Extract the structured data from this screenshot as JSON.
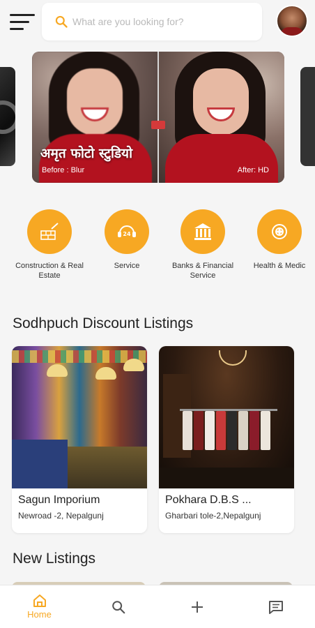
{
  "search": {
    "placeholder": "What are you looking for?"
  },
  "banner": {
    "title": "अमृत फोटो स्टुडियो",
    "before_label": "Before : Blur",
    "after_label": "After: HD"
  },
  "categories": [
    {
      "label": "Construction & Real Estate",
      "icon": "brick-wall-trowel-icon"
    },
    {
      "label": "Service",
      "icon": "24-hour-service-icon"
    },
    {
      "label": "Banks & Financial Service",
      "icon": "bank-building-icon"
    },
    {
      "label": "Health & Medic",
      "icon": "medical-icon"
    }
  ],
  "sections": {
    "discount_title": "Sodhpuch Discount Listings",
    "new_title": "New Listings"
  },
  "listings": [
    {
      "name": "Sagun Imporium",
      "address": "Newroad -2, Nepalgunj"
    },
    {
      "name": "Pokhara D.B.S ...",
      "address": "Gharbari tole-2,Nepalgunj"
    }
  ],
  "bottom_nav": {
    "home_label": "Home",
    "search_icon": "search-icon",
    "add_icon": "plus-icon",
    "messages_icon": "chat-icon"
  },
  "colors": {
    "accent": "#f7a823",
    "background": "#f5f5f5"
  }
}
